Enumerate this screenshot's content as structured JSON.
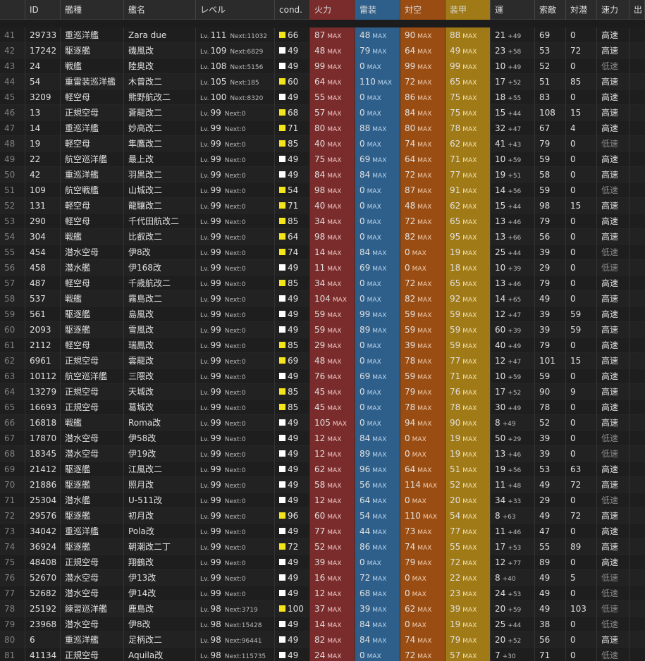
{
  "header": {
    "no": "",
    "id": "ID",
    "type": "艦種",
    "name": "艦名",
    "level": "レベル",
    "cond": "cond.",
    "fire": "火力",
    "torpedo": "雷装",
    "aa": "対空",
    "armor": "装甲",
    "luck": "運",
    "scout": "索敵",
    "asw": "対潜",
    "speed": "速力",
    "out": "出"
  },
  "labels": {
    "lv_prefix": "Lv.",
    "next_prefix": "Next:",
    "max": "MAX"
  },
  "colors": {
    "cond_white": "#ffffff",
    "cond_yellow": "#f4e41a",
    "fire": "#7a2b2b",
    "torpedo": "#2e5f8a",
    "aa": "#9a4d12",
    "armor": "#a07a16"
  },
  "rows": [
    {
      "no": "41",
      "id": "29733",
      "type": "重巡洋艦",
      "name": "Zara due",
      "lv": "111",
      "next": "11032",
      "cond": "66",
      "cc": "y",
      "fire": "87",
      "torp": "48",
      "aa": "90",
      "armor": "88",
      "luck": "21",
      "luckp": "+49",
      "scout": "69",
      "asw": "0",
      "speed": "高速"
    },
    {
      "no": "42",
      "id": "17242",
      "type": "駆逐艦",
      "name": "磯風改",
      "lv": "109",
      "next": "6829",
      "cond": "49",
      "cc": "w",
      "fire": "48",
      "torp": "79",
      "aa": "64",
      "armor": "49",
      "luck": "23",
      "luckp": "+58",
      "scout": "53",
      "asw": "72",
      "speed": "高速"
    },
    {
      "no": "43",
      "id": "24",
      "type": "戦艦",
      "name": "陸奥改",
      "lv": "108",
      "next": "5156",
      "cond": "49",
      "cc": "w",
      "fire": "99",
      "torp": "0",
      "aa": "99",
      "armor": "99",
      "luck": "10",
      "luckp": "+49",
      "scout": "52",
      "asw": "0",
      "speed": "低速"
    },
    {
      "no": "44",
      "id": "54",
      "type": "重雷装巡洋艦",
      "name": "木曾改二",
      "lv": "105",
      "next": "185",
      "cond": "60",
      "cc": "y",
      "fire": "64",
      "torp": "110",
      "aa": "72",
      "armor": "65",
      "luck": "17",
      "luckp": "+52",
      "scout": "51",
      "asw": "85",
      "speed": "高速"
    },
    {
      "no": "45",
      "id": "3209",
      "type": "軽空母",
      "name": "熊野航改二",
      "lv": "100",
      "next": "8320",
      "cond": "49",
      "cc": "w",
      "fire": "55",
      "torp": "0",
      "aa": "86",
      "armor": "75",
      "luck": "18",
      "luckp": "+55",
      "scout": "83",
      "asw": "0",
      "speed": "高速"
    },
    {
      "no": "46",
      "id": "13",
      "type": "正規空母",
      "name": "蒼龍改二",
      "lv": "99",
      "next": "0",
      "cond": "68",
      "cc": "y",
      "fire": "57",
      "torp": "0",
      "aa": "84",
      "armor": "75",
      "luck": "15",
      "luckp": "+44",
      "scout": "108",
      "asw": "15",
      "speed": "高速"
    },
    {
      "no": "47",
      "id": "14",
      "type": "重巡洋艦",
      "name": "妙高改二",
      "lv": "99",
      "next": "0",
      "cond": "71",
      "cc": "y",
      "fire": "80",
      "torp": "88",
      "aa": "80",
      "armor": "78",
      "luck": "32",
      "luckp": "+47",
      "scout": "67",
      "asw": "4",
      "speed": "高速"
    },
    {
      "no": "48",
      "id": "19",
      "type": "軽空母",
      "name": "隼鷹改二",
      "lv": "99",
      "next": "0",
      "cond": "85",
      "cc": "y",
      "fire": "40",
      "torp": "0",
      "aa": "74",
      "armor": "62",
      "luck": "41",
      "luckp": "+43",
      "scout": "79",
      "asw": "0",
      "speed": "低速"
    },
    {
      "no": "49",
      "id": "22",
      "type": "航空巡洋艦",
      "name": "最上改",
      "lv": "99",
      "next": "0",
      "cond": "49",
      "cc": "w",
      "fire": "75",
      "torp": "69",
      "aa": "64",
      "armor": "71",
      "luck": "10",
      "luckp": "+59",
      "scout": "59",
      "asw": "0",
      "speed": "高速"
    },
    {
      "no": "50",
      "id": "42",
      "type": "重巡洋艦",
      "name": "羽黒改二",
      "lv": "99",
      "next": "0",
      "cond": "49",
      "cc": "w",
      "fire": "84",
      "torp": "84",
      "aa": "72",
      "armor": "77",
      "luck": "19",
      "luckp": "+51",
      "scout": "58",
      "asw": "0",
      "speed": "高速"
    },
    {
      "no": "51",
      "id": "109",
      "type": "航空戦艦",
      "name": "山城改二",
      "lv": "99",
      "next": "0",
      "cond": "54",
      "cc": "y",
      "fire": "98",
      "torp": "0",
      "aa": "87",
      "armor": "91",
      "luck": "14",
      "luckp": "+56",
      "scout": "59",
      "asw": "0",
      "speed": "低速"
    },
    {
      "no": "52",
      "id": "131",
      "type": "軽空母",
      "name": "龍驤改二",
      "lv": "99",
      "next": "0",
      "cond": "71",
      "cc": "y",
      "fire": "40",
      "torp": "0",
      "aa": "48",
      "armor": "62",
      "luck": "15",
      "luckp": "+44",
      "scout": "98",
      "asw": "15",
      "speed": "高速"
    },
    {
      "no": "53",
      "id": "290",
      "type": "軽空母",
      "name": "千代田航改二",
      "lv": "99",
      "next": "0",
      "cond": "85",
      "cc": "y",
      "fire": "34",
      "torp": "0",
      "aa": "72",
      "armor": "65",
      "luck": "13",
      "luckp": "+46",
      "scout": "79",
      "asw": "0",
      "speed": "高速"
    },
    {
      "no": "54",
      "id": "304",
      "type": "戦艦",
      "name": "比叡改二",
      "lv": "99",
      "next": "0",
      "cond": "64",
      "cc": "y",
      "fire": "98",
      "torp": "0",
      "aa": "82",
      "armor": "95",
      "luck": "13",
      "luckp": "+66",
      "scout": "56",
      "asw": "0",
      "speed": "高速"
    },
    {
      "no": "55",
      "id": "454",
      "type": "潜水空母",
      "name": "伊8改",
      "lv": "99",
      "next": "0",
      "cond": "74",
      "cc": "y",
      "fire": "14",
      "torp": "84",
      "aa": "0",
      "armor": "19",
      "luck": "25",
      "luckp": "+44",
      "scout": "39",
      "asw": "0",
      "speed": "低速"
    },
    {
      "no": "56",
      "id": "458",
      "type": "潜水艦",
      "name": "伊168改",
      "lv": "99",
      "next": "0",
      "cond": "49",
      "cc": "w",
      "fire": "11",
      "torp": "69",
      "aa": "0",
      "armor": "18",
      "luck": "10",
      "luckp": "+39",
      "scout": "29",
      "asw": "0",
      "speed": "低速"
    },
    {
      "no": "57",
      "id": "487",
      "type": "軽空母",
      "name": "千歳航改二",
      "lv": "99",
      "next": "0",
      "cond": "85",
      "cc": "y",
      "fire": "34",
      "torp": "0",
      "aa": "72",
      "armor": "65",
      "luck": "13",
      "luckp": "+46",
      "scout": "79",
      "asw": "0",
      "speed": "高速"
    },
    {
      "no": "58",
      "id": "537",
      "type": "戦艦",
      "name": "霧島改二",
      "lv": "99",
      "next": "0",
      "cond": "49",
      "cc": "w",
      "fire": "104",
      "torp": "0",
      "aa": "82",
      "armor": "92",
      "luck": "14",
      "luckp": "+65",
      "scout": "49",
      "asw": "0",
      "speed": "高速"
    },
    {
      "no": "59",
      "id": "561",
      "type": "駆逐艦",
      "name": "島風改",
      "lv": "99",
      "next": "0",
      "cond": "49",
      "cc": "w",
      "fire": "59",
      "torp": "99",
      "aa": "59",
      "armor": "59",
      "luck": "12",
      "luckp": "+47",
      "scout": "39",
      "asw": "59",
      "speed": "高速"
    },
    {
      "no": "60",
      "id": "2093",
      "type": "駆逐艦",
      "name": "雪風改",
      "lv": "99",
      "next": "0",
      "cond": "49",
      "cc": "w",
      "fire": "59",
      "torp": "89",
      "aa": "59",
      "armor": "59",
      "luck": "60",
      "luckp": "+39",
      "scout": "39",
      "asw": "59",
      "speed": "高速"
    },
    {
      "no": "61",
      "id": "2112",
      "type": "軽空母",
      "name": "瑞鳳改",
      "lv": "99",
      "next": "0",
      "cond": "85",
      "cc": "y",
      "fire": "29",
      "torp": "0",
      "aa": "39",
      "armor": "59",
      "luck": "40",
      "luckp": "+49",
      "scout": "79",
      "asw": "0",
      "speed": "高速"
    },
    {
      "no": "62",
      "id": "6961",
      "type": "正規空母",
      "name": "雲龍改",
      "lv": "99",
      "next": "0",
      "cond": "69",
      "cc": "y",
      "fire": "48",
      "torp": "0",
      "aa": "78",
      "armor": "77",
      "luck": "12",
      "luckp": "+47",
      "scout": "101",
      "asw": "15",
      "speed": "高速"
    },
    {
      "no": "63",
      "id": "10112",
      "type": "航空巡洋艦",
      "name": "三隈改",
      "lv": "99",
      "next": "0",
      "cond": "49",
      "cc": "w",
      "fire": "76",
      "torp": "69",
      "aa": "59",
      "armor": "71",
      "luck": "10",
      "luckp": "+59",
      "scout": "59",
      "asw": "0",
      "speed": "高速"
    },
    {
      "no": "64",
      "id": "13279",
      "type": "正規空母",
      "name": "天城改",
      "lv": "99",
      "next": "0",
      "cond": "85",
      "cc": "y",
      "fire": "45",
      "torp": "0",
      "aa": "79",
      "armor": "76",
      "luck": "17",
      "luckp": "+52",
      "scout": "90",
      "asw": "9",
      "speed": "高速"
    },
    {
      "no": "65",
      "id": "16693",
      "type": "正規空母",
      "name": "葛城改",
      "lv": "99",
      "next": "0",
      "cond": "85",
      "cc": "y",
      "fire": "45",
      "torp": "0",
      "aa": "78",
      "armor": "78",
      "luck": "30",
      "luckp": "+49",
      "scout": "78",
      "asw": "0",
      "speed": "高速"
    },
    {
      "no": "66",
      "id": "16818",
      "type": "戦艦",
      "name": "Roma改",
      "lv": "99",
      "next": "0",
      "cond": "49",
      "cc": "w",
      "fire": "105",
      "torp": "0",
      "aa": "94",
      "armor": "90",
      "luck": "8",
      "luckp": "+49",
      "scout": "52",
      "asw": "0",
      "speed": "高速"
    },
    {
      "no": "67",
      "id": "17870",
      "type": "潜水空母",
      "name": "伊58改",
      "lv": "99",
      "next": "0",
      "cond": "49",
      "cc": "w",
      "fire": "12",
      "torp": "84",
      "aa": "0",
      "armor": "19",
      "luck": "50",
      "luckp": "+29",
      "scout": "39",
      "asw": "0",
      "speed": "低速"
    },
    {
      "no": "68",
      "id": "18345",
      "type": "潜水空母",
      "name": "伊19改",
      "lv": "99",
      "next": "0",
      "cond": "49",
      "cc": "w",
      "fire": "12",
      "torp": "89",
      "aa": "0",
      "armor": "19",
      "luck": "13",
      "luckp": "+46",
      "scout": "39",
      "asw": "0",
      "speed": "低速"
    },
    {
      "no": "69",
      "id": "21412",
      "type": "駆逐艦",
      "name": "江風改二",
      "lv": "99",
      "next": "0",
      "cond": "49",
      "cc": "w",
      "fire": "62",
      "torp": "96",
      "aa": "64",
      "armor": "51",
      "luck": "19",
      "luckp": "+56",
      "scout": "53",
      "asw": "63",
      "speed": "高速"
    },
    {
      "no": "70",
      "id": "21886",
      "type": "駆逐艦",
      "name": "照月改",
      "lv": "99",
      "next": "0",
      "cond": "49",
      "cc": "w",
      "fire": "58",
      "torp": "56",
      "aa": "114",
      "armor": "52",
      "luck": "11",
      "luckp": "+48",
      "scout": "49",
      "asw": "72",
      "speed": "高速"
    },
    {
      "no": "71",
      "id": "25304",
      "type": "潜水艦",
      "name": "U-511改",
      "lv": "99",
      "next": "0",
      "cond": "49",
      "cc": "w",
      "fire": "12",
      "torp": "64",
      "aa": "0",
      "armor": "20",
      "luck": "34",
      "luckp": "+33",
      "scout": "29",
      "asw": "0",
      "speed": "低速"
    },
    {
      "no": "72",
      "id": "29576",
      "type": "駆逐艦",
      "name": "初月改",
      "lv": "99",
      "next": "0",
      "cond": "96",
      "cc": "y",
      "fire": "60",
      "torp": "54",
      "aa": "110",
      "armor": "54",
      "luck": "8",
      "luckp": "+63",
      "scout": "49",
      "asw": "72",
      "speed": "高速"
    },
    {
      "no": "73",
      "id": "34042",
      "type": "重巡洋艦",
      "name": "Pola改",
      "lv": "99",
      "next": "0",
      "cond": "49",
      "cc": "w",
      "fire": "77",
      "torp": "44",
      "aa": "73",
      "armor": "77",
      "luck": "11",
      "luckp": "+46",
      "scout": "47",
      "asw": "0",
      "speed": "高速"
    },
    {
      "no": "74",
      "id": "36924",
      "type": "駆逐艦",
      "name": "朝潮改二丁",
      "lv": "99",
      "next": "0",
      "cond": "72",
      "cc": "y",
      "fire": "52",
      "torp": "86",
      "aa": "74",
      "armor": "55",
      "luck": "17",
      "luckp": "+53",
      "scout": "55",
      "asw": "89",
      "speed": "高速"
    },
    {
      "no": "75",
      "id": "48408",
      "type": "正規空母",
      "name": "翔鶴改",
      "lv": "99",
      "next": "0",
      "cond": "49",
      "cc": "w",
      "fire": "39",
      "torp": "0",
      "aa": "79",
      "armor": "72",
      "luck": "12",
      "luckp": "+77",
      "scout": "89",
      "asw": "0",
      "speed": "高速"
    },
    {
      "no": "76",
      "id": "52670",
      "type": "潜水空母",
      "name": "伊13改",
      "lv": "99",
      "next": "0",
      "cond": "49",
      "cc": "w",
      "fire": "16",
      "torp": "72",
      "aa": "0",
      "armor": "22",
      "luck": "8",
      "luckp": "+40",
      "scout": "49",
      "asw": "5",
      "speed": "低速"
    },
    {
      "no": "77",
      "id": "52682",
      "type": "潜水空母",
      "name": "伊14改",
      "lv": "99",
      "next": "0",
      "cond": "49",
      "cc": "w",
      "fire": "12",
      "torp": "68",
      "aa": "0",
      "armor": "23",
      "luck": "24",
      "luckp": "+53",
      "scout": "49",
      "asw": "0",
      "speed": "低速"
    },
    {
      "no": "78",
      "id": "25192",
      "type": "練習巡洋艦",
      "name": "鹿島改",
      "lv": "98",
      "next": "3719",
      "cond": "100",
      "cc": "y",
      "fire": "37",
      "torp": "39",
      "aa": "62",
      "armor": "39",
      "luck": "20",
      "luckp": "+59",
      "scout": "49",
      "asw": "103",
      "speed": "低速"
    },
    {
      "no": "79",
      "id": "23968",
      "type": "潜水空母",
      "name": "伊8改",
      "lv": "98",
      "next": "15428",
      "cond": "49",
      "cc": "w",
      "fire": "14",
      "torp": "84",
      "aa": "0",
      "armor": "19",
      "luck": "25",
      "luckp": "+44",
      "scout": "38",
      "asw": "0",
      "speed": "低速"
    },
    {
      "no": "80",
      "id": "6",
      "type": "重巡洋艦",
      "name": "足柄改二",
      "lv": "98",
      "next": "96441",
      "cond": "49",
      "cc": "w",
      "fire": "82",
      "torp": "84",
      "aa": "74",
      "armor": "79",
      "luck": "20",
      "luckp": "+52",
      "scout": "56",
      "asw": "0",
      "speed": "高速"
    },
    {
      "no": "81",
      "id": "41134",
      "type": "正規空母",
      "name": "Aquila改",
      "lv": "98",
      "next": "115735",
      "cond": "49",
      "cc": "w",
      "fire": "24",
      "torp": "0",
      "aa": "72",
      "armor": "57",
      "luck": "7",
      "luckp": "+30",
      "scout": "71",
      "asw": "0",
      "speed": "低速"
    }
  ]
}
